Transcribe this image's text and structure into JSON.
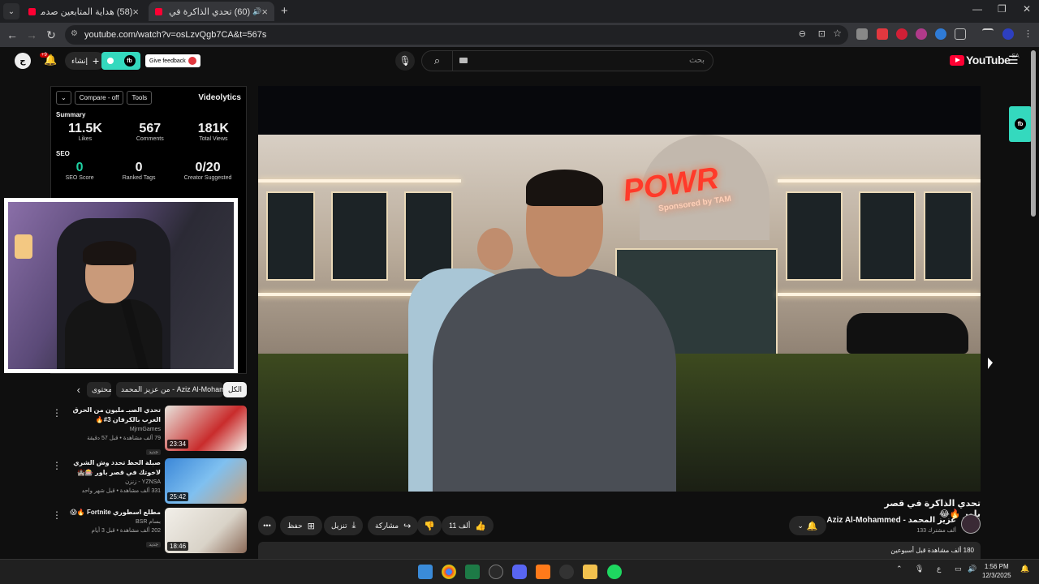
{
  "browser": {
    "tabs": [
      {
        "title": "(58) هداية المتابعين صدموني بال",
        "active": false
      },
      {
        "title": "(60) تحدي الذاكرة في قصر باو",
        "active": true
      }
    ],
    "new_tab": "+",
    "url": "youtube.com/watch?v=osLzvQgb7CA&t=567s"
  },
  "youtube_header": {
    "search_placeholder": "بحث",
    "create_label": "إنشاء",
    "feedback_label": "Give feedback",
    "logo_text": "YouTube",
    "region": "SA",
    "notifications_badge": "+9"
  },
  "videolytics": {
    "compare_label": "Compare - off",
    "tools_label": "Tools",
    "brand": "Videolytics",
    "summary_heading": "Summary",
    "stats": [
      {
        "value": "11.5K",
        "label": "Likes"
      },
      {
        "value": "567",
        "label": "Comments"
      },
      {
        "value": "181K",
        "label": "Total Views"
      }
    ],
    "seo_heading": "SEO",
    "seo": [
      {
        "value": "0",
        "label": "SEO Score"
      },
      {
        "value": "0",
        "label": "Ranked Tags"
      },
      {
        "value": "0/20",
        "label": "Creator Suggested"
      }
    ]
  },
  "filter_chips": [
    {
      "label": "الكل",
      "active": true
    },
    {
      "label": "من عزيز المحمد - Aziz Al-Mohammed",
      "active": false
    },
    {
      "label": "محتوى",
      "active": false
    }
  ],
  "recommendations": [
    {
      "title": "تحدي الصبـ مليون من الحرق الغرب بالكرفان 3#🔥",
      "channel": "MjrmGames",
      "meta": "79 ألف مشاهدة • قبل 57 دقيقة",
      "badge": "جديد",
      "duration": "23:34"
    },
    {
      "title": "صبلة الحظ تحدد وش الشري لاخوتك في قصر باور 🎰🏰",
      "channel": "YZNSA - زنزن",
      "meta": "331 ألف مشاهدة • قبل شهر واحد",
      "badge": "",
      "duration": "25:42"
    },
    {
      "title": "مطلع اسطوري Fortnite 🔥😱",
      "channel": "بسام BSR",
      "meta": "202 ألف مشاهدة • قبل 3 أيام",
      "badge": "جديد",
      "duration": "18:46"
    }
  ],
  "video": {
    "title": "تحدي الذاكرة في قصر باور 🔥😂",
    "sign_text": "POWR",
    "sign_sub": "Sponsored by TAM",
    "likes": "11 ألف",
    "share_label": "مشاركة",
    "download_label": "تنزيل",
    "save_label": "حفظ",
    "more_label": "•••",
    "channel_name": "Aziz Al-Mohammed - عزيز المحمد",
    "subscribers": "133 ألف مشترك",
    "views_line": "180 ألف مشاهدة قبل أسبوعين"
  },
  "taskbar": {
    "time": "1:56 PM",
    "date": "12/3/2025",
    "lang": "ع"
  },
  "colors": {
    "accent_teal": "#34d9be",
    "youtube_red": "#ff0033"
  }
}
